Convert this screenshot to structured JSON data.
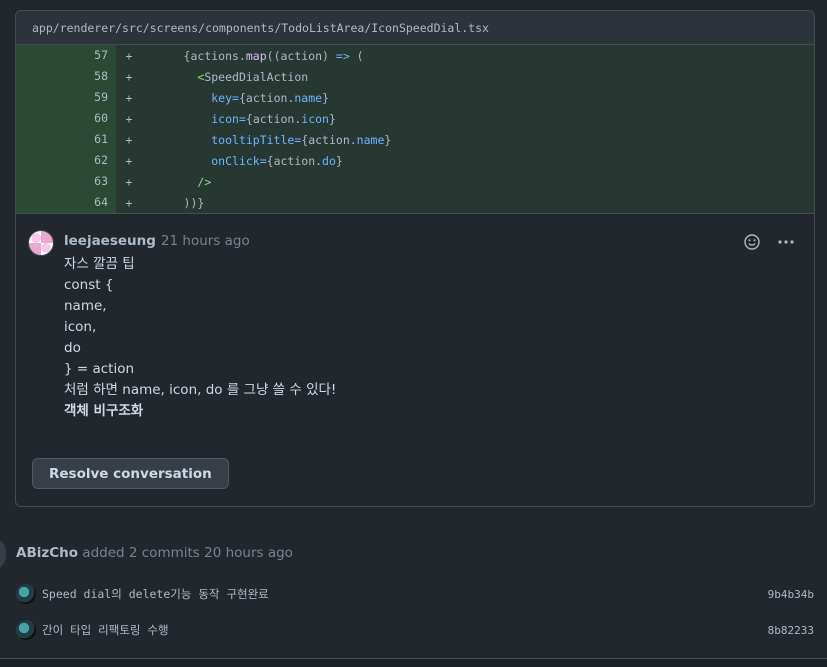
{
  "file": {
    "path": "app/renderer/src/screens/components/TodoListArea/IconSpeedDial.tsx"
  },
  "diff": [
    {
      "ln": "57",
      "sign": "+",
      "segs": [
        [
          "      ",
          ""
        ],
        [
          "{actions.",
          ""
        ],
        [
          "map",
          "fn"
        ],
        [
          "((action) ",
          ""
        ],
        [
          "=>",
          "op"
        ],
        [
          " (",
          ""
        ]
      ]
    },
    {
      "ln": "58",
      "sign": "+",
      "segs": [
        [
          "        ",
          ""
        ],
        [
          "<",
          "tag"
        ],
        [
          "SpeedDialAction",
          ""
        ]
      ]
    },
    {
      "ln": "59",
      "sign": "+",
      "segs": [
        [
          "          ",
          ""
        ],
        [
          "key",
          "attr"
        ],
        [
          "=",
          "op"
        ],
        [
          "{action.",
          ""
        ],
        [
          "name",
          "attr"
        ],
        [
          "}",
          ""
        ]
      ]
    },
    {
      "ln": "60",
      "sign": "+",
      "segs": [
        [
          "          ",
          ""
        ],
        [
          "icon",
          "attr"
        ],
        [
          "=",
          "op"
        ],
        [
          "{action.",
          ""
        ],
        [
          "icon",
          "attr"
        ],
        [
          "}",
          ""
        ]
      ]
    },
    {
      "ln": "61",
      "sign": "+",
      "segs": [
        [
          "          ",
          ""
        ],
        [
          "tooltipTitle",
          "attr"
        ],
        [
          "=",
          "op"
        ],
        [
          "{action.",
          ""
        ],
        [
          "name",
          "attr"
        ],
        [
          "}",
          ""
        ]
      ]
    },
    {
      "ln": "62",
      "sign": "+",
      "segs": [
        [
          "          ",
          ""
        ],
        [
          "onClick",
          "attr"
        ],
        [
          "=",
          "op"
        ],
        [
          "{action.",
          ""
        ],
        [
          "do",
          "attr"
        ],
        [
          "}",
          ""
        ]
      ]
    },
    {
      "ln": "63",
      "sign": "+",
      "segs": [
        [
          "        ",
          ""
        ],
        [
          "/>",
          "tag"
        ]
      ]
    },
    {
      "ln": "64",
      "sign": "+",
      "segs": [
        [
          "      ",
          ""
        ],
        [
          "))}",
          ""
        ]
      ]
    }
  ],
  "comment": {
    "author": "leejaeseung",
    "time": "21 hours ago",
    "lines": [
      "자스 깔끔 팁",
      "const {",
      "name,",
      "icon,",
      "do",
      "} = action",
      "처럼 하면 name, icon, do 를 그냥 쓸 수 있다!"
    ],
    "bold_line": "객체 비구조화",
    "emoji_icon": "smiley-icon",
    "more_icon": "kebab-horizontal-icon"
  },
  "resolve_label": "Resolve conversation",
  "event": {
    "who": "ABizCho",
    "what": " added 2 commits 20 hours ago"
  },
  "commits": [
    {
      "msg": "Speed dial의 delete기능 동작 구현완료",
      "sha": "9b4b34b"
    },
    {
      "msg": "간이 타입 리팩토링 수행",
      "sha": "8b82233"
    }
  ]
}
